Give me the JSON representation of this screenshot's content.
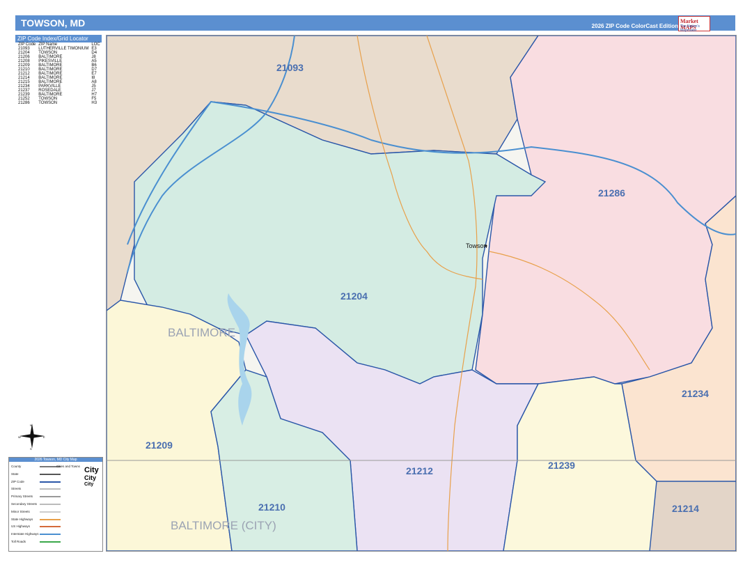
{
  "header": {
    "title": "TOWSON, MD",
    "edition": "2026 ZIP Code ColorCast Edition",
    "logo": "Market MAPS",
    "logo_tagline": "The Nation's Mapmaker"
  },
  "zip_index": {
    "heading": "ZIP Code Index/Grid Locator",
    "columns": [
      "ZIP Code",
      "ZIP Name",
      "LOC"
    ],
    "rows": [
      [
        "21093",
        "LUTHERVILLE TIMONIUM",
        "E3"
      ],
      [
        "21204",
        "TOWSON",
        "D4"
      ],
      [
        "21206",
        "BALTIMORE",
        "J8"
      ],
      [
        "21208",
        "PIKESVILLE",
        "A5"
      ],
      [
        "21209",
        "BALTIMORE",
        "B6"
      ],
      [
        "21210",
        "BALTIMORE",
        "D7"
      ],
      [
        "21212",
        "BALTIMORE",
        "E7"
      ],
      [
        "21214",
        "BALTIMORE",
        "I8"
      ],
      [
        "21215",
        "BALTIMORE",
        "A8"
      ],
      [
        "21234",
        "PARKVILLE",
        "J5"
      ],
      [
        "21237",
        "ROSEDALE",
        "J7"
      ],
      [
        "21239",
        "BALTIMORE",
        "H7"
      ],
      [
        "21252",
        "TOWSON",
        "F5"
      ],
      [
        "21286",
        "TOWSON",
        "H3"
      ]
    ]
  },
  "map": {
    "zip_labels": [
      "21093",
      "21204",
      "21286",
      "21234",
      "21209",
      "21210",
      "21212",
      "21239",
      "21214"
    ],
    "city_labels": [
      "BALTIMORE",
      "BALTIMORE (CITY)"
    ],
    "town_label": "Towson",
    "colors": {
      "z21093": "#e9dccd",
      "z21204": "#d4ece3",
      "z21286": "#f9dde1",
      "z21234": "#fbe4d0",
      "z21209": "#fcf7d8",
      "z21210": "#d8eee4",
      "z21212": "#ebe2f3",
      "z21239": "#fcf8dc",
      "z21214": "#e3d5c8",
      "boundary": "#2a56a8",
      "water": "#a9d4ec",
      "highway": "#e8a04a",
      "interstate": "#4a8fd0"
    }
  },
  "compass": {
    "n": "N",
    "s": "S",
    "e": "E",
    "w": "W"
  },
  "key": {
    "title": "2026 Towson, MD City Map",
    "rows": [
      "County",
      "State",
      "ZIP Code",
      "Streets",
      "Primary Streets",
      "Secondary Streets",
      "Minor Streets",
      "State Highways",
      "US Highways",
      "Interstate Highways",
      "Toll Roads"
    ],
    "cities_heading": "Cities and Towns",
    "city_sizes": [
      "City",
      "City",
      "City"
    ]
  }
}
